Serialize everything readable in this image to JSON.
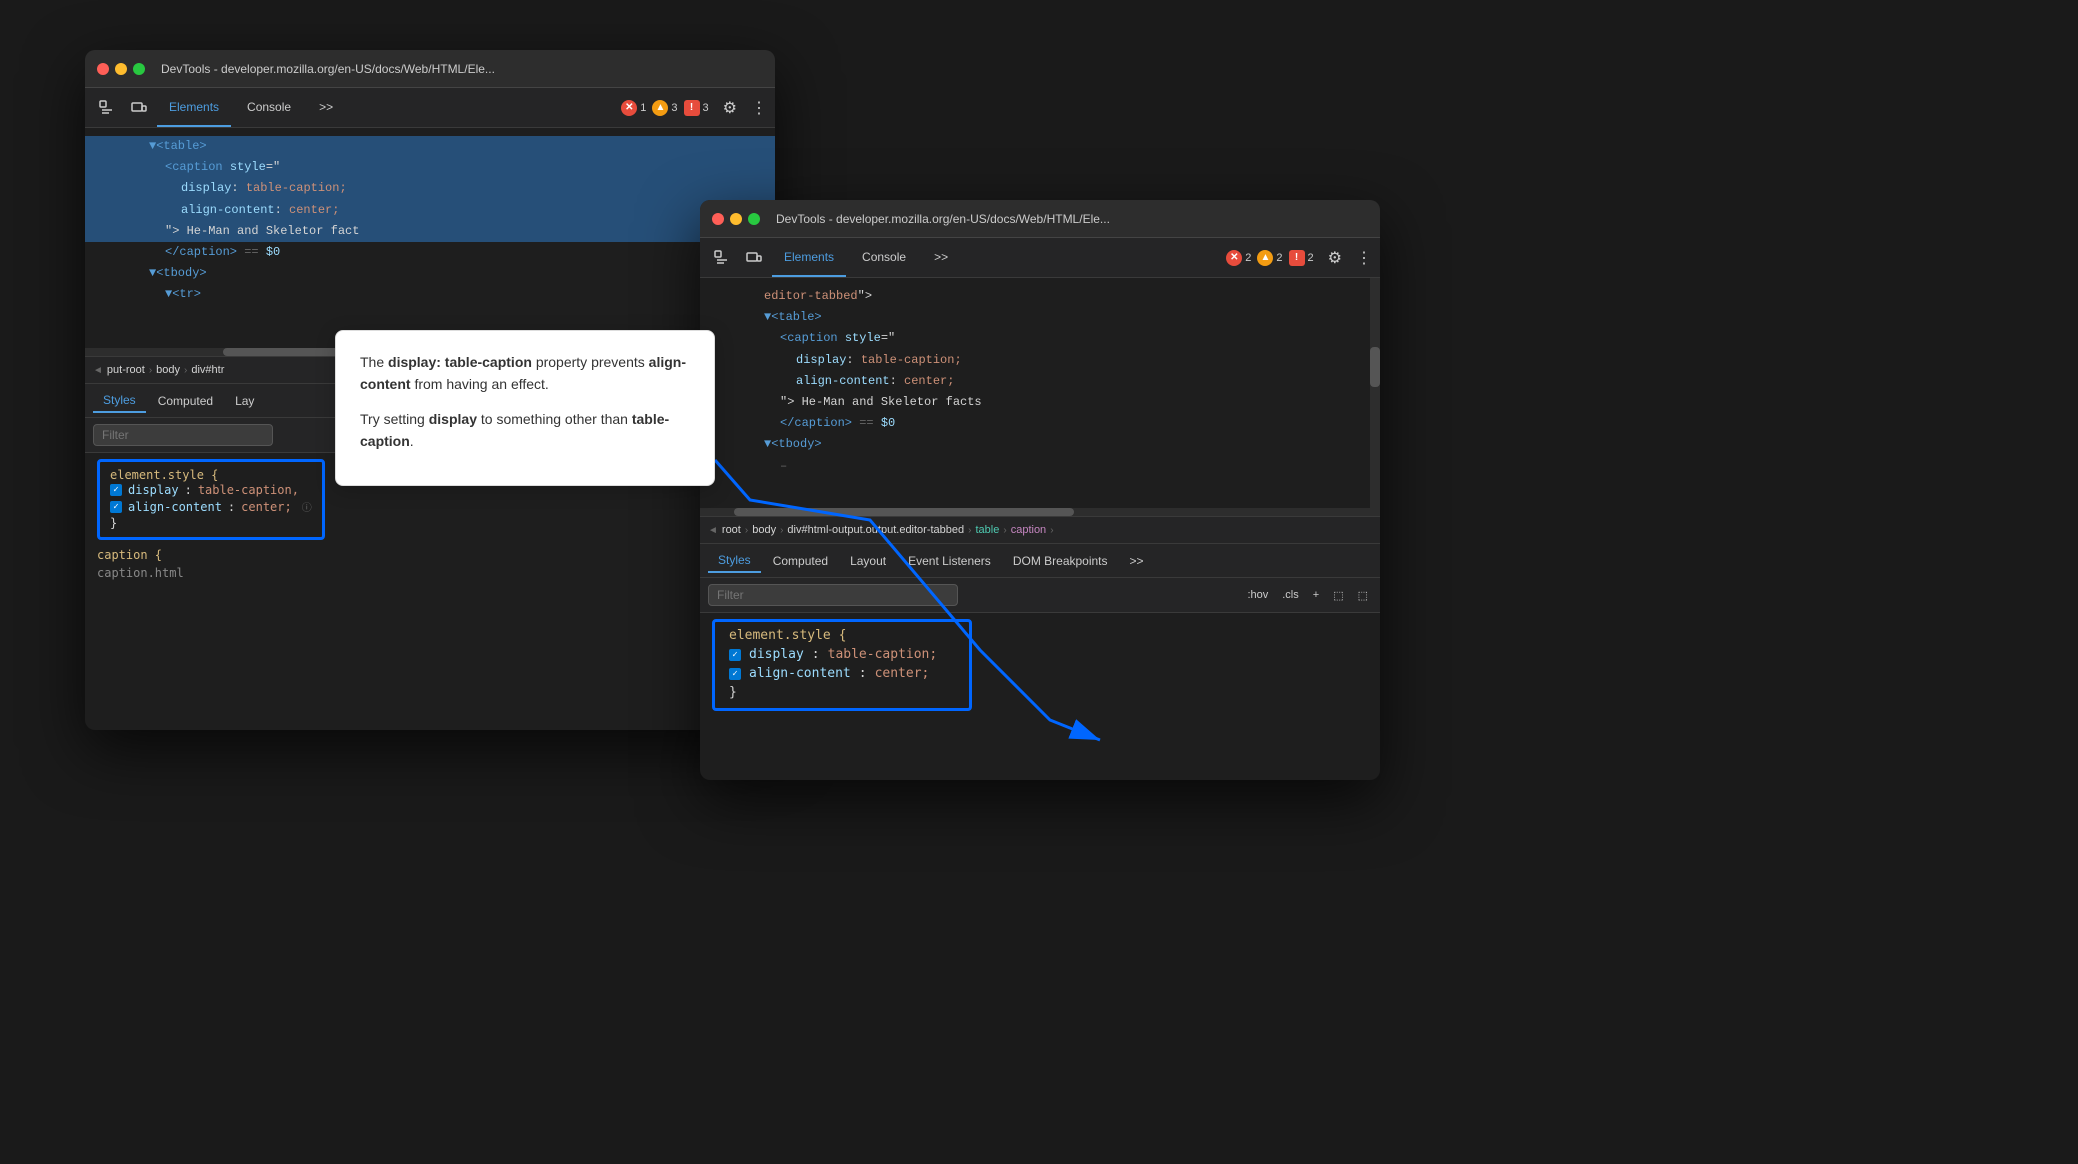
{
  "window1": {
    "title": "DevTools - developer.mozilla.org/en-US/docs/Web/HTML/Ele...",
    "tabs": {
      "elements": "Elements",
      "console": "Console",
      "more": ">>",
      "active": "elements"
    },
    "badges": {
      "error": {
        "icon": "✕",
        "count": "1"
      },
      "warn": {
        "icon": "▲",
        "count": "3"
      },
      "info": {
        "icon": "!",
        "count": "3"
      }
    },
    "code_lines": [
      {
        "indent": 3,
        "content": "▼<table>",
        "type": "tag",
        "highlighted": true
      },
      {
        "indent": 4,
        "content": "<caption style=\"",
        "type": "tag",
        "highlighted": true
      },
      {
        "indent": 5,
        "content": "display: table-caption;",
        "type": "css",
        "highlighted": true
      },
      {
        "indent": 5,
        "content": "align-content: center;",
        "type": "css",
        "highlighted": true
      },
      {
        "indent": 4,
        "content": "\"> He-Man and Skeletor facts",
        "type": "text",
        "highlighted": true
      },
      {
        "indent": 4,
        "content": "</caption> == $0",
        "type": "tag",
        "highlighted": false
      },
      {
        "indent": 3,
        "content": "▼<tbody>",
        "type": "tag"
      },
      {
        "indent": 4,
        "content": "▼<tr>",
        "type": "tag"
      }
    ],
    "breadcrumb": [
      "◄",
      "put-root",
      "body",
      "div#htr"
    ],
    "style_tabs": [
      "Styles",
      "Computed",
      "Lay"
    ],
    "filter_placeholder": "Filter",
    "element_style": {
      "selector": "element.style {",
      "props": [
        {
          "prop": "display:",
          "val": "table-caption,"
        },
        {
          "prop": "align-content:",
          "val": "center;"
        }
      ],
      "close": "}"
    },
    "caption_text": "caption {"
  },
  "window2": {
    "title": "DevTools - developer.mozilla.org/en-US/docs/Web/HTML/Ele...",
    "tabs": {
      "elements": "Elements",
      "console": "Console",
      "more": ">>",
      "active": "elements"
    },
    "badges": {
      "error": {
        "icon": "✕",
        "count": "2"
      },
      "warn": {
        "icon": "▲",
        "count": "2"
      },
      "info": {
        "icon": "!",
        "count": "2"
      }
    },
    "code_lines": [
      {
        "indent": 3,
        "content": "editor-tabbed\">",
        "type": "text"
      },
      {
        "indent": 3,
        "content": "▼<table>",
        "type": "tag",
        "highlighted": false
      },
      {
        "indent": 4,
        "content": "<caption style=\"",
        "type": "tag"
      },
      {
        "indent": 5,
        "content": "display: table-caption;",
        "type": "css"
      },
      {
        "indent": 5,
        "content": "align-content: center;",
        "type": "css"
      },
      {
        "indent": 4,
        "content": "\"> He-Man and Skeletor facts",
        "type": "text"
      },
      {
        "indent": 4,
        "content": "</caption> == $0",
        "type": "tag"
      },
      {
        "indent": 3,
        "content": "▼<tbody>",
        "type": "tag"
      },
      {
        "indent": 4,
        "content": "–",
        "type": "tag"
      }
    ],
    "scrollbar": true,
    "breadcrumb": [
      "◄",
      "root",
      "body",
      "div#html-output.output.editor-tabbed",
      "table",
      "caption"
    ],
    "style_tabs": [
      "Styles",
      "Computed",
      "Layout",
      "Event Listeners",
      "DOM Breakpoints",
      ">>"
    ],
    "filter_placeholder": "Filter",
    "filter_btns": [
      ":hov",
      ".cls",
      "+",
      "⬚",
      "⬚"
    ],
    "element_style": {
      "selector": "element.style {",
      "props": [
        {
          "prop": "display:",
          "val": "table-caption;"
        },
        {
          "prop": "align-content:",
          "val": "center;"
        }
      ],
      "close": "}"
    }
  },
  "hint_box": {
    "text1_prefix": "The ",
    "text1_bold1": "display: table-caption",
    "text1_suffix": " property prevents ",
    "text1_bold2": "align-content",
    "text1_end": " from having an effect.",
    "text2_prefix": "Try setting ",
    "text2_bold": "display",
    "text2_suffix": " to something other than ",
    "text2_code": "table-caption",
    "text2_end": "."
  }
}
